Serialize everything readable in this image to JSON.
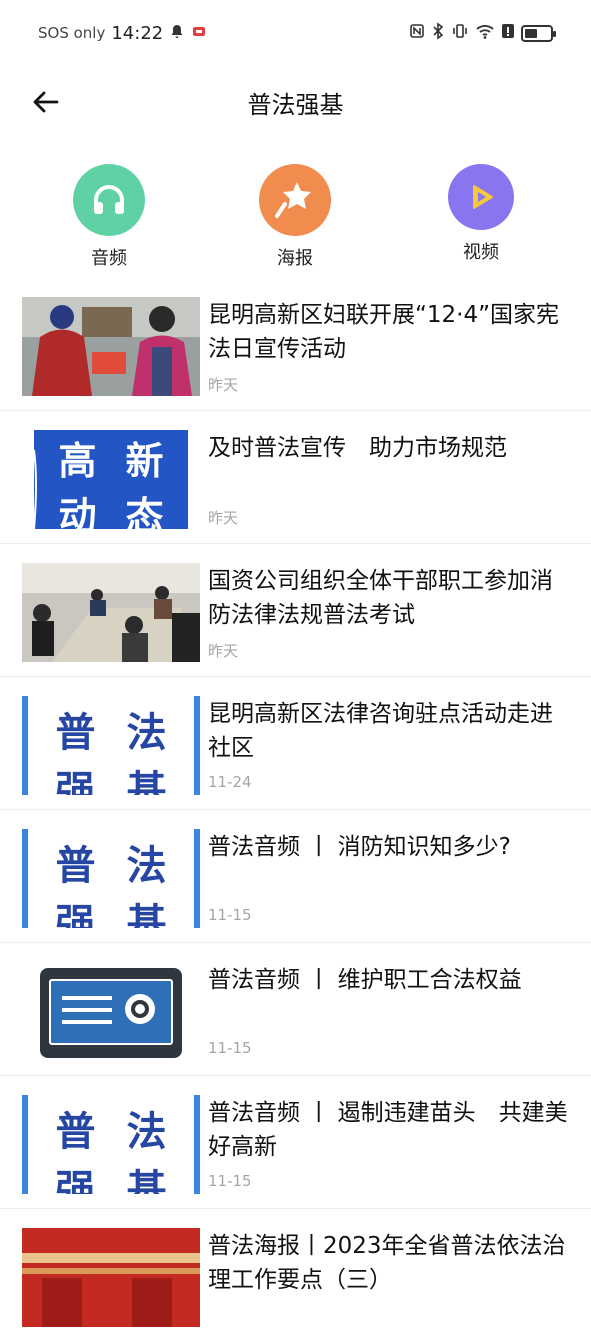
{
  "status_bar": {
    "carrier": "SOS only",
    "time": "14:22"
  },
  "header": {
    "title": "普法强基"
  },
  "categories": [
    {
      "label": "音频",
      "icon": "headphones-icon",
      "color": "#5fd1a4"
    },
    {
      "label": "海报",
      "icon": "star-wand-icon",
      "color": "#f08c4e"
    },
    {
      "label": "视频",
      "icon": "play-icon",
      "color": "#8a75f0"
    }
  ],
  "news": [
    {
      "title": "昆明高新区妇联开展“12·4”国家宪法日宣传活动",
      "date": "昨天",
      "thumb": "photo-street"
    },
    {
      "title": "及时普法宣传　助力市场规范",
      "date": "昨天",
      "thumb": "高新动态",
      "thumb_chars": [
        "高",
        "新",
        "动",
        "态"
      ]
    },
    {
      "title": "国资公司组织全体干部职工参加消防法律法规普法考试",
      "date": "昨天",
      "thumb": "photo-exam"
    },
    {
      "title": "昆明高新区法律咨询驻点活动走进社区",
      "date": "11-24",
      "thumb": "普法强基",
      "thumb_chars": [
        "普",
        "法",
        "强",
        "基"
      ]
    },
    {
      "title": "普法音频 丨 消防知识知多少?",
      "date": "11-15",
      "thumb": "普法强基",
      "thumb_chars": [
        "普",
        "法",
        "强",
        "基"
      ]
    },
    {
      "title": "普法音频 丨 维护职工合法权益",
      "date": "11-15",
      "thumb": "radio-icon"
    },
    {
      "title": "普法音频 丨 遏制违建苗头　共建美好高新",
      "date": "11-15",
      "thumb": "普法强基",
      "thumb_chars": [
        "普",
        "法",
        "强",
        "基"
      ]
    },
    {
      "title": "普法海报丨2023年全省普法依法治理工作要点（三）",
      "date": "",
      "thumb": "photo-poster"
    }
  ]
}
